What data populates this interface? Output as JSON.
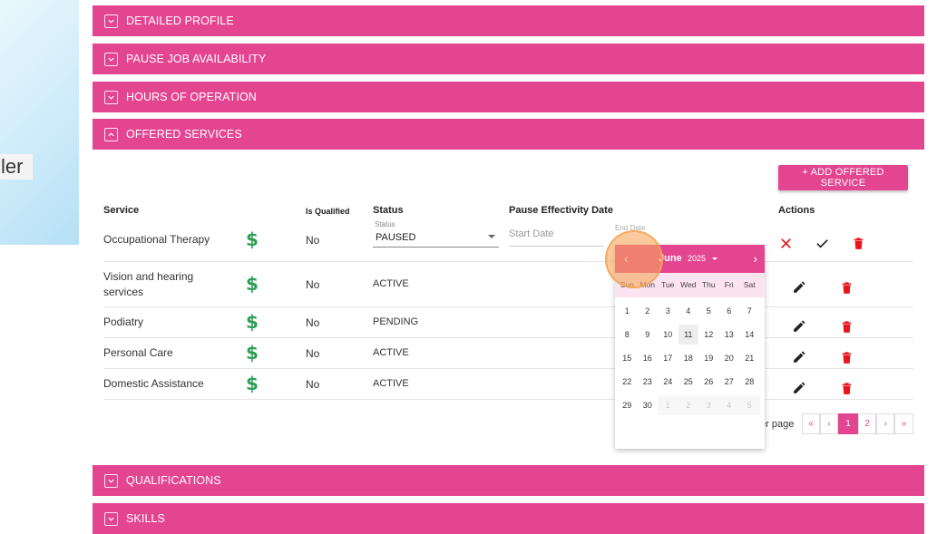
{
  "left_text": "ler",
  "accordions": {
    "detailed_profile": "DETAILED PROFILE",
    "pause_job": "PAUSE JOB AVAILABILITY",
    "hours": "HOURS OF OPERATION",
    "offered_services": "OFFERED SERVICES",
    "qualifications": "QUALIFICATIONS",
    "skills": "SKILLS"
  },
  "add_button": "+ ADD OFFERED SERVICE",
  "table": {
    "headers": {
      "service": "Service",
      "is_qualified": "Is Qualified",
      "status": "Status",
      "pause_date": "Pause Effectivity Date",
      "actions": "Actions"
    },
    "currency_symbol": "$",
    "edit_row": {
      "service": "Occupational Therapy",
      "qualified": "No",
      "status_label": "Status",
      "status_value": "PAUSED",
      "start_placeholder": "Start Date",
      "end_label": "End Date"
    },
    "rows": [
      {
        "service": "Vision and hearing services",
        "qualified": "No",
        "status": "ACTIVE"
      },
      {
        "service": "Podiatry",
        "qualified": "No",
        "status": "PENDING"
      },
      {
        "service": "Personal Care",
        "qualified": "No",
        "status": "ACTIVE"
      },
      {
        "service": "Domestic Assistance",
        "qualified": "No",
        "status": "ACTIVE"
      }
    ]
  },
  "pagination": {
    "label": "er page",
    "first": "«",
    "prev": "‹",
    "pages": [
      "1",
      "2"
    ],
    "next": "›",
    "last": "»"
  },
  "calendar": {
    "prev": "‹",
    "next": "›",
    "month": "June",
    "year": "2025",
    "weekdays": [
      "Sun",
      "Mon",
      "Tue",
      "Wed",
      "Thu",
      "Fri",
      "Sat"
    ],
    "weeks": [
      [
        "1",
        "2",
        "3",
        "4",
        "5",
        "6",
        "7"
      ],
      [
        "8",
        "9",
        "10",
        "11",
        "12",
        "13",
        "14"
      ],
      [
        "15",
        "16",
        "17",
        "18",
        "19",
        "20",
        "21"
      ],
      [
        "22",
        "23",
        "24",
        "25",
        "26",
        "27",
        "28"
      ],
      [
        "29",
        "30",
        "1",
        "2",
        "3",
        "4",
        "5"
      ]
    ]
  },
  "colors": {
    "accent": "#e44591",
    "dollar": "#2e9e55",
    "delete": "#e8151b",
    "cancel": "#e8151b"
  }
}
